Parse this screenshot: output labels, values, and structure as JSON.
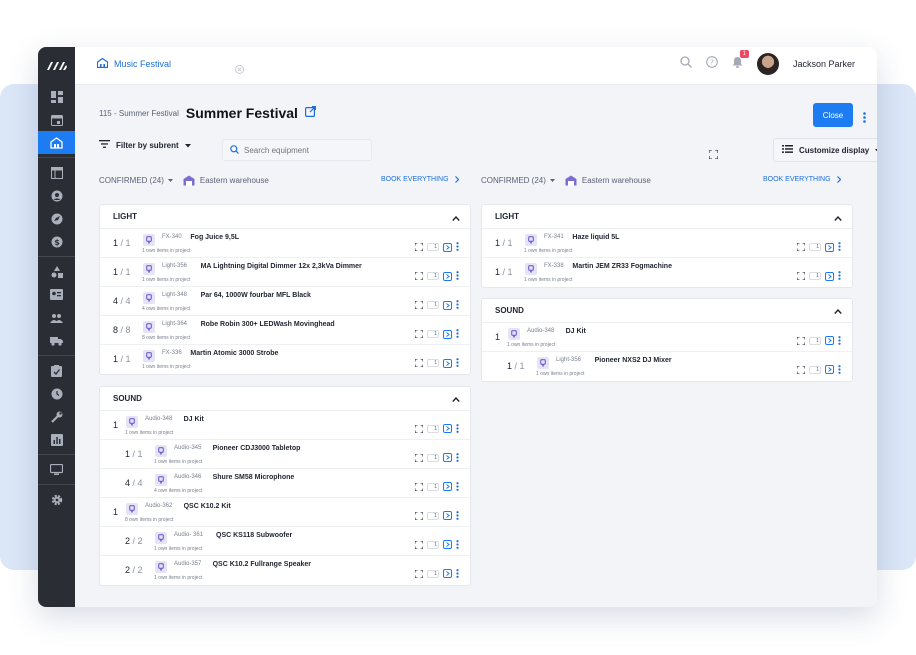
{
  "app": {
    "tab_label": "Music Festival",
    "user_name": "Jackson Parker",
    "notification_count": "1"
  },
  "page": {
    "crumb": "115 - Summer Festival",
    "title": "Summer Festival",
    "close_label": "Close",
    "filter_label": "Filter by subrent",
    "search_placeholder": "Search equipment",
    "customize_label": "Customize display"
  },
  "columns": [
    {
      "status": "CONFIRMED (24)",
      "warehouse": "Eastern warehouse",
      "book_all": "BOOK EVERYTHING",
      "groups": [
        {
          "title": "LIGHT",
          "rows": [
            {
              "qty": "1",
              "total": "1",
              "code": "FX-340",
              "name": "Fog Juice 9,5L",
              "sub": "1 own items in project",
              "level": 0
            },
            {
              "qty": "1",
              "total": "1",
              "code": "Light-356",
              "name": "MA Lightning Digital Dimmer 12x 2,3kVa Dimmer",
              "sub": "1 own items in project",
              "level": 0
            },
            {
              "qty": "4",
              "total": "4",
              "code": "Light-348",
              "name": "Par 64, 1000W fourbar MFL Black",
              "sub": "4 own items in project",
              "level": 0
            },
            {
              "qty": "8",
              "total": "8",
              "code": "Light-364",
              "name": "Robe Robin 300+ LEDWash Movinghead",
              "sub": "8 own items in project",
              "level": 0
            },
            {
              "qty": "1",
              "total": "1",
              "code": "FX-336",
              "name": "Martin Atomic 3000 Strobe",
              "sub": "1 own items in project",
              "level": 0
            }
          ]
        },
        {
          "title": "SOUND",
          "rows": [
            {
              "qty": "1",
              "total": "",
              "code": "Audio-348",
              "name": "DJ Kit",
              "sub": "1 own items in project",
              "level": 0
            },
            {
              "qty": "1",
              "total": "1",
              "code": "Audio-345",
              "name": "Pioneer CDJ3000 Tabletop",
              "sub": "1 own items in project",
              "level": 1
            },
            {
              "qty": "4",
              "total": "4",
              "code": "Audio-346",
              "name": "Shure SM58 Microphone",
              "sub": "4 own items in project",
              "level": 1
            },
            {
              "qty": "1",
              "total": "",
              "code": "Audio-362",
              "name": "QSC K10.2 Kit",
              "sub": "8 own items in project",
              "level": 0
            },
            {
              "qty": "2",
              "total": "2",
              "code": "Audio- 361",
              "name": "QSC KS118 Subwoofer",
              "sub": "1 own items in project",
              "level": 1
            },
            {
              "qty": "2",
              "total": "2",
              "code": "Audio-357",
              "name": "QSC K10.2 Fullrange Speaker",
              "sub": "1 own items in project",
              "level": 1
            }
          ]
        }
      ]
    },
    {
      "status": "CONFIRMED (24)",
      "warehouse": "Eastern warehouse",
      "book_all": "BOOK EVERYTHING",
      "groups": [
        {
          "title": "LIGHT",
          "rows": [
            {
              "qty": "1",
              "total": "1",
              "code": "FX-341",
              "name": "Haze liquid 5L",
              "sub": "1 own items in project",
              "level": 0
            },
            {
              "qty": "1",
              "total": "1",
              "code": "FX-338",
              "name": "Martin JEM ZR33 Fogmachine",
              "sub": "1 own items in project",
              "level": 0
            }
          ]
        },
        {
          "title": "SOUND",
          "rows": [
            {
              "qty": "1",
              "total": "",
              "code": "Audio-348",
              "name": "DJ Kit",
              "sub": "1 own items in project",
              "level": 0
            },
            {
              "qty": "1",
              "total": "1",
              "code": "Light-356",
              "name": "Pioneer NXS2 DJ Mixer",
              "sub": "1 own items in project",
              "level": 1
            }
          ]
        }
      ]
    }
  ],
  "row_action_count": "1",
  "colors": {
    "accent": "#1e7cf2",
    "sidebar": "#2a2d33",
    "badge": "#ef4661"
  }
}
